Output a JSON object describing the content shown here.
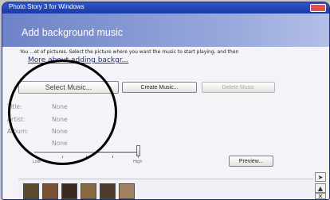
{
  "window": {
    "title": "Photo Story 3 for Windows"
  },
  "header": {
    "title": "Add background music"
  },
  "instructions": {
    "text": "You ...et of pictures.  Select the picture where you want the music to start playing, and then",
    "link": "More about adding backgr..."
  },
  "buttons": {
    "select_music": "Select Music...",
    "create_music": "Create Music...",
    "delete_music": "Delete Music",
    "preview": "Preview..."
  },
  "music_info": [
    {
      "label": "Title:",
      "value": "None"
    },
    {
      "label": "Artist:",
      "value": "None"
    },
    {
      "label": "Album:",
      "value": "None"
    },
    {
      "label": "",
      "value": "None"
    }
  ],
  "volume": {
    "low_label": "Low",
    "high_label": "High",
    "level": 1.0
  },
  "filmstrip": {
    "thumb_colors": [
      "#5b4a2e",
      "#7a5030",
      "#3a2a20",
      "#8a6a40",
      "#4d3a2a",
      "#a08060"
    ]
  },
  "nav_icons": [
    "right-arrow-icon",
    "up-arrow-icon",
    "close-icon"
  ]
}
